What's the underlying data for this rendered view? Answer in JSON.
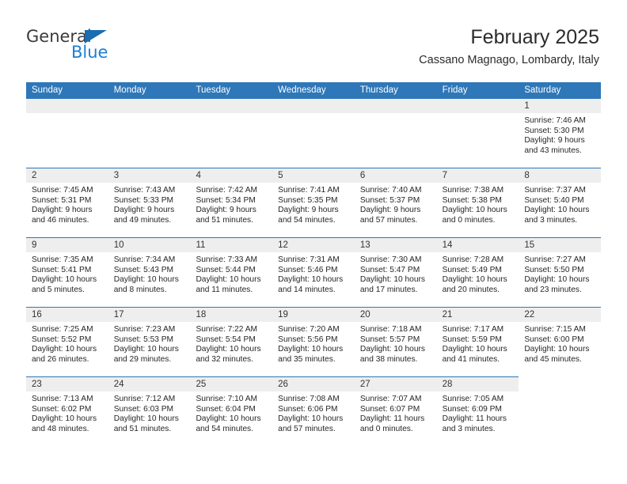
{
  "brand": {
    "name_top": "General",
    "name_bottom": "Blue",
    "triangle_color": "#1b6cb0",
    "blue_text_color": "#1b7fd4"
  },
  "header": {
    "title": "February 2025",
    "subtitle": "Cassano Magnago, Lombardy, Italy"
  },
  "theme": {
    "header_blue": "#2e77b8",
    "daynum_band": "#eeeeee",
    "text": "#262626"
  },
  "weekdays": [
    "Sunday",
    "Monday",
    "Tuesday",
    "Wednesday",
    "Thursday",
    "Friday",
    "Saturday"
  ],
  "weeks": [
    [
      {
        "day": "",
        "sunrise": "",
        "sunset": "",
        "daylight_1": "",
        "daylight_2": "",
        "blank": true
      },
      {
        "day": "",
        "sunrise": "",
        "sunset": "",
        "daylight_1": "",
        "daylight_2": "",
        "blank": true
      },
      {
        "day": "",
        "sunrise": "",
        "sunset": "",
        "daylight_1": "",
        "daylight_2": "",
        "blank": true
      },
      {
        "day": "",
        "sunrise": "",
        "sunset": "",
        "daylight_1": "",
        "daylight_2": "",
        "blank": true
      },
      {
        "day": "",
        "sunrise": "",
        "sunset": "",
        "daylight_1": "",
        "daylight_2": "",
        "blank": true
      },
      {
        "day": "",
        "sunrise": "",
        "sunset": "",
        "daylight_1": "",
        "daylight_2": "",
        "blank": true
      },
      {
        "day": "1",
        "sunrise": "Sunrise: 7:46 AM",
        "sunset": "Sunset: 5:30 PM",
        "daylight_1": "Daylight: 9 hours",
        "daylight_2": "and 43 minutes.",
        "blank": false
      }
    ],
    [
      {
        "day": "2",
        "sunrise": "Sunrise: 7:45 AM",
        "sunset": "Sunset: 5:31 PM",
        "daylight_1": "Daylight: 9 hours",
        "daylight_2": "and 46 minutes.",
        "blank": false
      },
      {
        "day": "3",
        "sunrise": "Sunrise: 7:43 AM",
        "sunset": "Sunset: 5:33 PM",
        "daylight_1": "Daylight: 9 hours",
        "daylight_2": "and 49 minutes.",
        "blank": false
      },
      {
        "day": "4",
        "sunrise": "Sunrise: 7:42 AM",
        "sunset": "Sunset: 5:34 PM",
        "daylight_1": "Daylight: 9 hours",
        "daylight_2": "and 51 minutes.",
        "blank": false
      },
      {
        "day": "5",
        "sunrise": "Sunrise: 7:41 AM",
        "sunset": "Sunset: 5:35 PM",
        "daylight_1": "Daylight: 9 hours",
        "daylight_2": "and 54 minutes.",
        "blank": false
      },
      {
        "day": "6",
        "sunrise": "Sunrise: 7:40 AM",
        "sunset": "Sunset: 5:37 PM",
        "daylight_1": "Daylight: 9 hours",
        "daylight_2": "and 57 minutes.",
        "blank": false
      },
      {
        "day": "7",
        "sunrise": "Sunrise: 7:38 AM",
        "sunset": "Sunset: 5:38 PM",
        "daylight_1": "Daylight: 10 hours",
        "daylight_2": "and 0 minutes.",
        "blank": false
      },
      {
        "day": "8",
        "sunrise": "Sunrise: 7:37 AM",
        "sunset": "Sunset: 5:40 PM",
        "daylight_1": "Daylight: 10 hours",
        "daylight_2": "and 3 minutes.",
        "blank": false
      }
    ],
    [
      {
        "day": "9",
        "sunrise": "Sunrise: 7:35 AM",
        "sunset": "Sunset: 5:41 PM",
        "daylight_1": "Daylight: 10 hours",
        "daylight_2": "and 5 minutes.",
        "blank": false
      },
      {
        "day": "10",
        "sunrise": "Sunrise: 7:34 AM",
        "sunset": "Sunset: 5:43 PM",
        "daylight_1": "Daylight: 10 hours",
        "daylight_2": "and 8 minutes.",
        "blank": false
      },
      {
        "day": "11",
        "sunrise": "Sunrise: 7:33 AM",
        "sunset": "Sunset: 5:44 PM",
        "daylight_1": "Daylight: 10 hours",
        "daylight_2": "and 11 minutes.",
        "blank": false
      },
      {
        "day": "12",
        "sunrise": "Sunrise: 7:31 AM",
        "sunset": "Sunset: 5:46 PM",
        "daylight_1": "Daylight: 10 hours",
        "daylight_2": "and 14 minutes.",
        "blank": false
      },
      {
        "day": "13",
        "sunrise": "Sunrise: 7:30 AM",
        "sunset": "Sunset: 5:47 PM",
        "daylight_1": "Daylight: 10 hours",
        "daylight_2": "and 17 minutes.",
        "blank": false
      },
      {
        "day": "14",
        "sunrise": "Sunrise: 7:28 AM",
        "sunset": "Sunset: 5:49 PM",
        "daylight_1": "Daylight: 10 hours",
        "daylight_2": "and 20 minutes.",
        "blank": false
      },
      {
        "day": "15",
        "sunrise": "Sunrise: 7:27 AM",
        "sunset": "Sunset: 5:50 PM",
        "daylight_1": "Daylight: 10 hours",
        "daylight_2": "and 23 minutes.",
        "blank": false
      }
    ],
    [
      {
        "day": "16",
        "sunrise": "Sunrise: 7:25 AM",
        "sunset": "Sunset: 5:52 PM",
        "daylight_1": "Daylight: 10 hours",
        "daylight_2": "and 26 minutes.",
        "blank": false
      },
      {
        "day": "17",
        "sunrise": "Sunrise: 7:23 AM",
        "sunset": "Sunset: 5:53 PM",
        "daylight_1": "Daylight: 10 hours",
        "daylight_2": "and 29 minutes.",
        "blank": false
      },
      {
        "day": "18",
        "sunrise": "Sunrise: 7:22 AM",
        "sunset": "Sunset: 5:54 PM",
        "daylight_1": "Daylight: 10 hours",
        "daylight_2": "and 32 minutes.",
        "blank": false
      },
      {
        "day": "19",
        "sunrise": "Sunrise: 7:20 AM",
        "sunset": "Sunset: 5:56 PM",
        "daylight_1": "Daylight: 10 hours",
        "daylight_2": "and 35 minutes.",
        "blank": false
      },
      {
        "day": "20",
        "sunrise": "Sunrise: 7:18 AM",
        "sunset": "Sunset: 5:57 PM",
        "daylight_1": "Daylight: 10 hours",
        "daylight_2": "and 38 minutes.",
        "blank": false
      },
      {
        "day": "21",
        "sunrise": "Sunrise: 7:17 AM",
        "sunset": "Sunset: 5:59 PM",
        "daylight_1": "Daylight: 10 hours",
        "daylight_2": "and 41 minutes.",
        "blank": false
      },
      {
        "day": "22",
        "sunrise": "Sunrise: 7:15 AM",
        "sunset": "Sunset: 6:00 PM",
        "daylight_1": "Daylight: 10 hours",
        "daylight_2": "and 45 minutes.",
        "blank": false
      }
    ],
    [
      {
        "day": "23",
        "sunrise": "Sunrise: 7:13 AM",
        "sunset": "Sunset: 6:02 PM",
        "daylight_1": "Daylight: 10 hours",
        "daylight_2": "and 48 minutes.",
        "blank": false
      },
      {
        "day": "24",
        "sunrise": "Sunrise: 7:12 AM",
        "sunset": "Sunset: 6:03 PM",
        "daylight_1": "Daylight: 10 hours",
        "daylight_2": "and 51 minutes.",
        "blank": false
      },
      {
        "day": "25",
        "sunrise": "Sunrise: 7:10 AM",
        "sunset": "Sunset: 6:04 PM",
        "daylight_1": "Daylight: 10 hours",
        "daylight_2": "and 54 minutes.",
        "blank": false
      },
      {
        "day": "26",
        "sunrise": "Sunrise: 7:08 AM",
        "sunset": "Sunset: 6:06 PM",
        "daylight_1": "Daylight: 10 hours",
        "daylight_2": "and 57 minutes.",
        "blank": false
      },
      {
        "day": "27",
        "sunrise": "Sunrise: 7:07 AM",
        "sunset": "Sunset: 6:07 PM",
        "daylight_1": "Daylight: 11 hours",
        "daylight_2": "and 0 minutes.",
        "blank": false
      },
      {
        "day": "28",
        "sunrise": "Sunrise: 7:05 AM",
        "sunset": "Sunset: 6:09 PM",
        "daylight_1": "Daylight: 11 hours",
        "daylight_2": "and 3 minutes.",
        "blank": false
      },
      {
        "day": "",
        "sunrise": "",
        "sunset": "",
        "daylight_1": "",
        "daylight_2": "",
        "blank": true,
        "noline": true
      }
    ]
  ]
}
